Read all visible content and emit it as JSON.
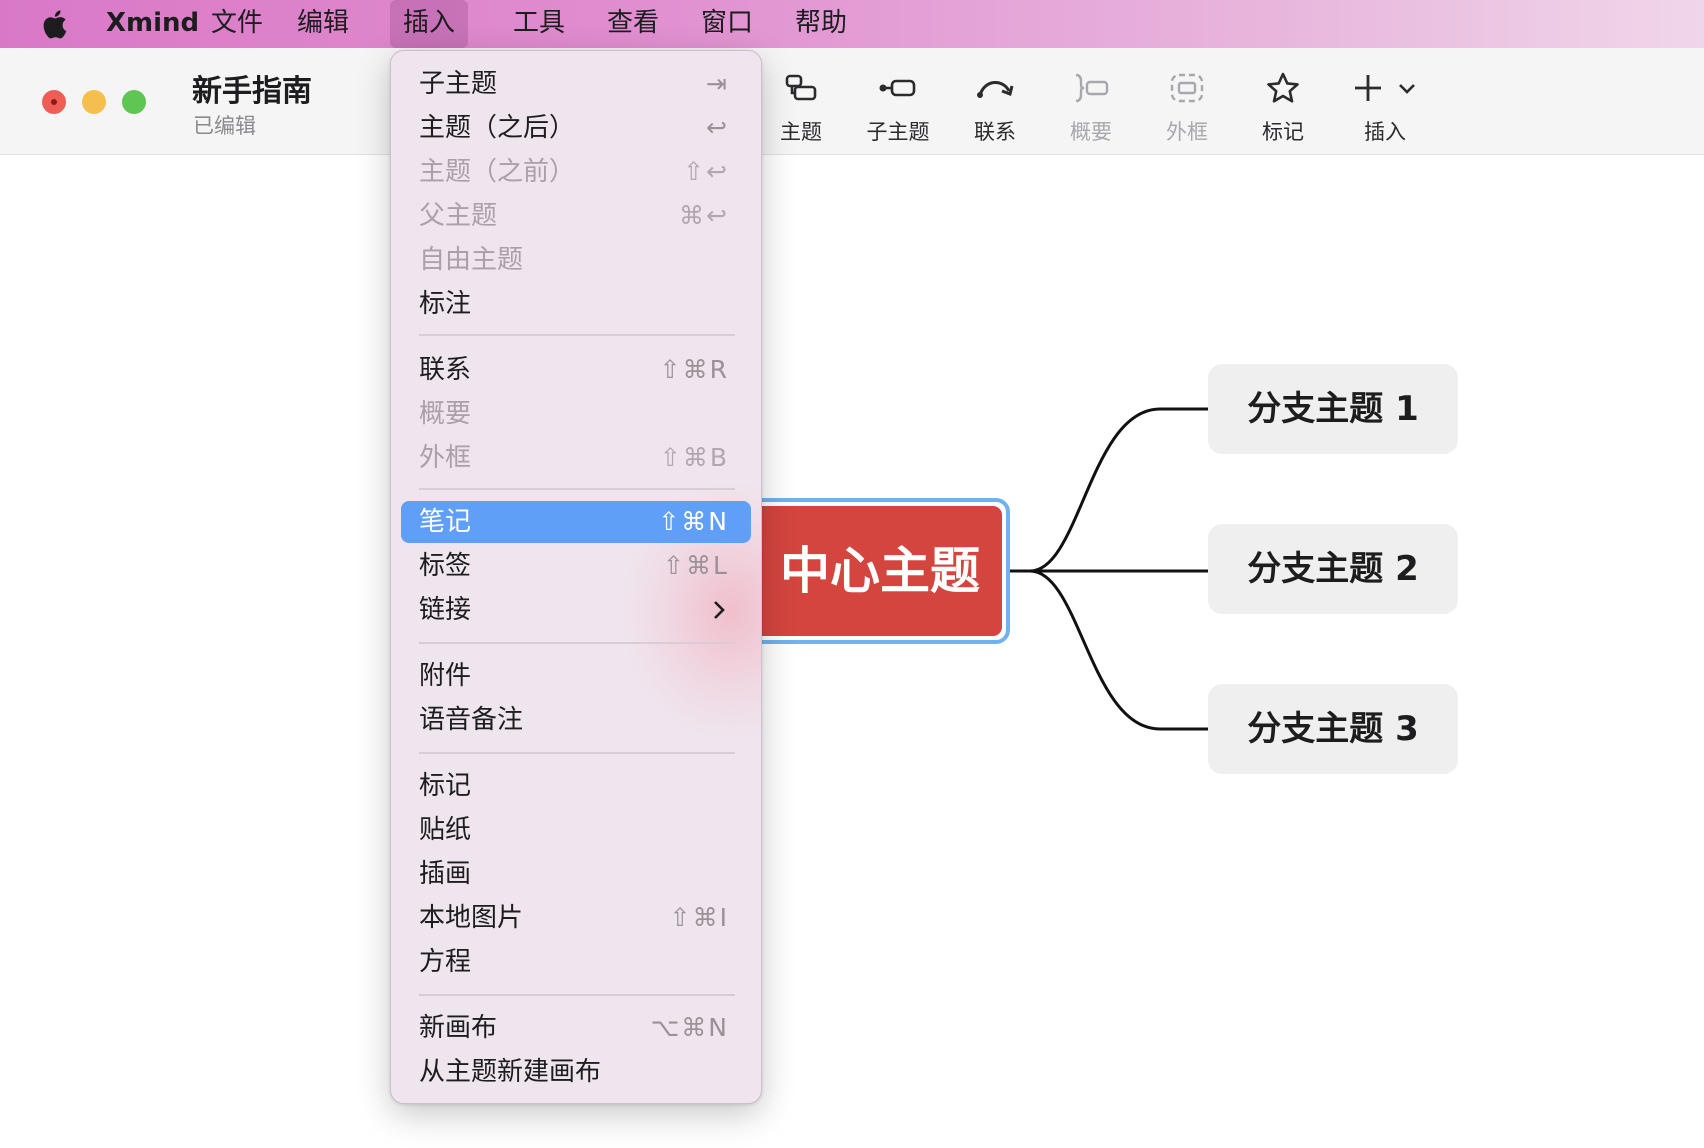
{
  "menubar": {
    "app": "Xmind",
    "items": [
      "文件",
      "编辑",
      "插入",
      "工具",
      "查看",
      "窗口",
      "帮助"
    ],
    "active": "插入"
  },
  "window": {
    "title": "新手指南",
    "subtitle": "已编辑"
  },
  "toolbar": {
    "topic": "主题",
    "subtopic": "子主题",
    "relationship": "联系",
    "summary": "概要",
    "boundary": "外框",
    "marker": "标记",
    "insert": "插入"
  },
  "mindmap": {
    "central": "中心主题",
    "central_visible": "中心主题",
    "branches": [
      "分支主题 1",
      "分支主题 2",
      "分支主题 3"
    ],
    "colors": {
      "central": "#d4453f",
      "selection": "#6fb2ee",
      "branch": "#efefef"
    }
  },
  "dropdown": {
    "items": [
      {
        "label": "子主题",
        "shortcut": "⇥",
        "disabled": false
      },
      {
        "label": "主题（之后）",
        "shortcut": "↩",
        "disabled": false
      },
      {
        "label": "主题（之前）",
        "shortcut": "⇧↩",
        "disabled": true
      },
      {
        "label": "父主题",
        "shortcut": "⌘↩",
        "disabled": true
      },
      {
        "label": "自由主题",
        "shortcut": "",
        "disabled": true
      },
      {
        "label": "标注",
        "shortcut": "",
        "disabled": false
      },
      {
        "label": "联系",
        "shortcut": "⇧⌘R",
        "disabled": false
      },
      {
        "label": "概要",
        "shortcut": "",
        "disabled": true
      },
      {
        "label": "外框",
        "shortcut": "⇧⌘B",
        "disabled": true
      },
      {
        "label": "笔记",
        "shortcut": "⇧⌘N",
        "disabled": false,
        "highlighted": true
      },
      {
        "label": "标签",
        "shortcut": "⇧⌘L",
        "disabled": false
      },
      {
        "label": "链接",
        "shortcut": "",
        "disabled": false,
        "submenu": true
      },
      {
        "label": "附件",
        "shortcut": "",
        "disabled": false
      },
      {
        "label": "语音备注",
        "shortcut": "",
        "disabled": false
      },
      {
        "label": "标记",
        "shortcut": "",
        "disabled": false
      },
      {
        "label": "贴纸",
        "shortcut": "",
        "disabled": false
      },
      {
        "label": "插画",
        "shortcut": "",
        "disabled": false
      },
      {
        "label": "本地图片",
        "shortcut": "⇧⌘I",
        "disabled": false
      },
      {
        "label": "方程",
        "shortcut": "",
        "disabled": false
      },
      {
        "label": "新画布",
        "shortcut": "⌥⌘N",
        "disabled": false
      },
      {
        "label": "从主题新建画布",
        "shortcut": "",
        "disabled": false
      }
    ],
    "highlight_color": "#5f9ff7"
  }
}
